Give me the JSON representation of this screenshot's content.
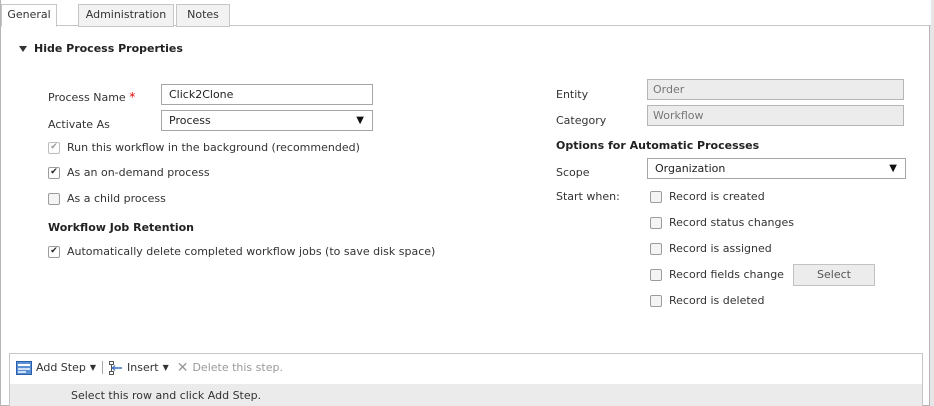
{
  "tabs": [
    {
      "label": "General"
    },
    {
      "label": "Administration"
    },
    {
      "label": "Notes"
    }
  ],
  "section": {
    "title": "Hide Process Properties"
  },
  "left": {
    "process_name_label": "Process Name",
    "required_mark": "*",
    "process_name_value": "Click2Clone",
    "activate_as_label": "Activate As",
    "activate_as_value": "Process",
    "cb_background": "Run this workflow in the background (recommended)",
    "cb_on_demand": "As an on-demand process",
    "cb_child": "As a child process",
    "retention_header": "Workflow Job Retention",
    "cb_auto_delete": "Automatically delete completed workflow jobs (to save disk space)"
  },
  "right": {
    "entity_label": "Entity",
    "entity_value": "Order",
    "category_label": "Category",
    "category_value": "Workflow",
    "options_header": "Options for Automatic Processes",
    "scope_label": "Scope",
    "scope_value": "Organization",
    "start_when_label": "Start when:",
    "start_options": [
      "Record is created",
      "Record status changes",
      "Record is assigned",
      "Record fields change",
      "Record is deleted"
    ],
    "select_button": "Select"
  },
  "steps": {
    "add_step": "Add Step",
    "insert": "Insert",
    "delete": "Delete this step.",
    "hint": "Select this row and click Add Step."
  },
  "icons": {
    "dropdown_arrow": "▼",
    "checkmark": "✔",
    "delete": "✕"
  }
}
